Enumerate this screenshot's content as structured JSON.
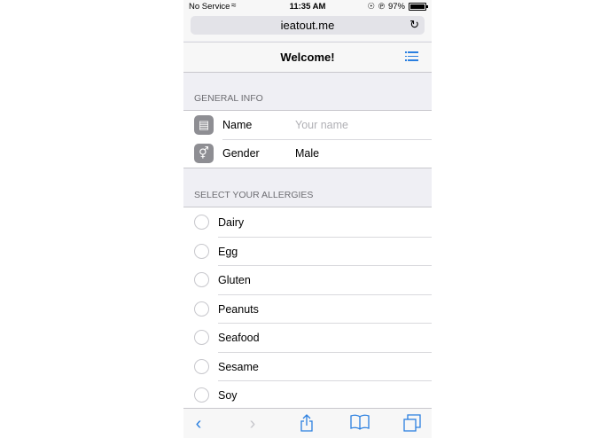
{
  "status_bar": {
    "carrier": "No Service",
    "time": "11:35 AM",
    "battery": "97%",
    "battery_level": 0.97
  },
  "address_bar": {
    "url": "ieatout.me"
  },
  "nav": {
    "title": "Welcome!",
    "menu_icon": "list-icon"
  },
  "general_info": {
    "header": "GENERAL INFO",
    "name": {
      "label": "Name",
      "placeholder": "Your name",
      "icon": "id-card-icon"
    },
    "gender": {
      "label": "Gender",
      "value": "Male",
      "icon": "gender-icon"
    }
  },
  "allergies": {
    "header": "SELECT YOUR ALLERGIES",
    "items": [
      "Dairy",
      "Egg",
      "Gluten",
      "Peanuts",
      "Seafood",
      "Sesame",
      "Soy"
    ]
  },
  "toolbar": {
    "icons": [
      "back-icon",
      "forward-icon",
      "share-icon",
      "bookmarks-icon",
      "tabs-icon"
    ]
  },
  "colors": {
    "accent": "#2a7fe0",
    "group_bg": "#efeff4",
    "icon_bg": "#8e8e93"
  }
}
